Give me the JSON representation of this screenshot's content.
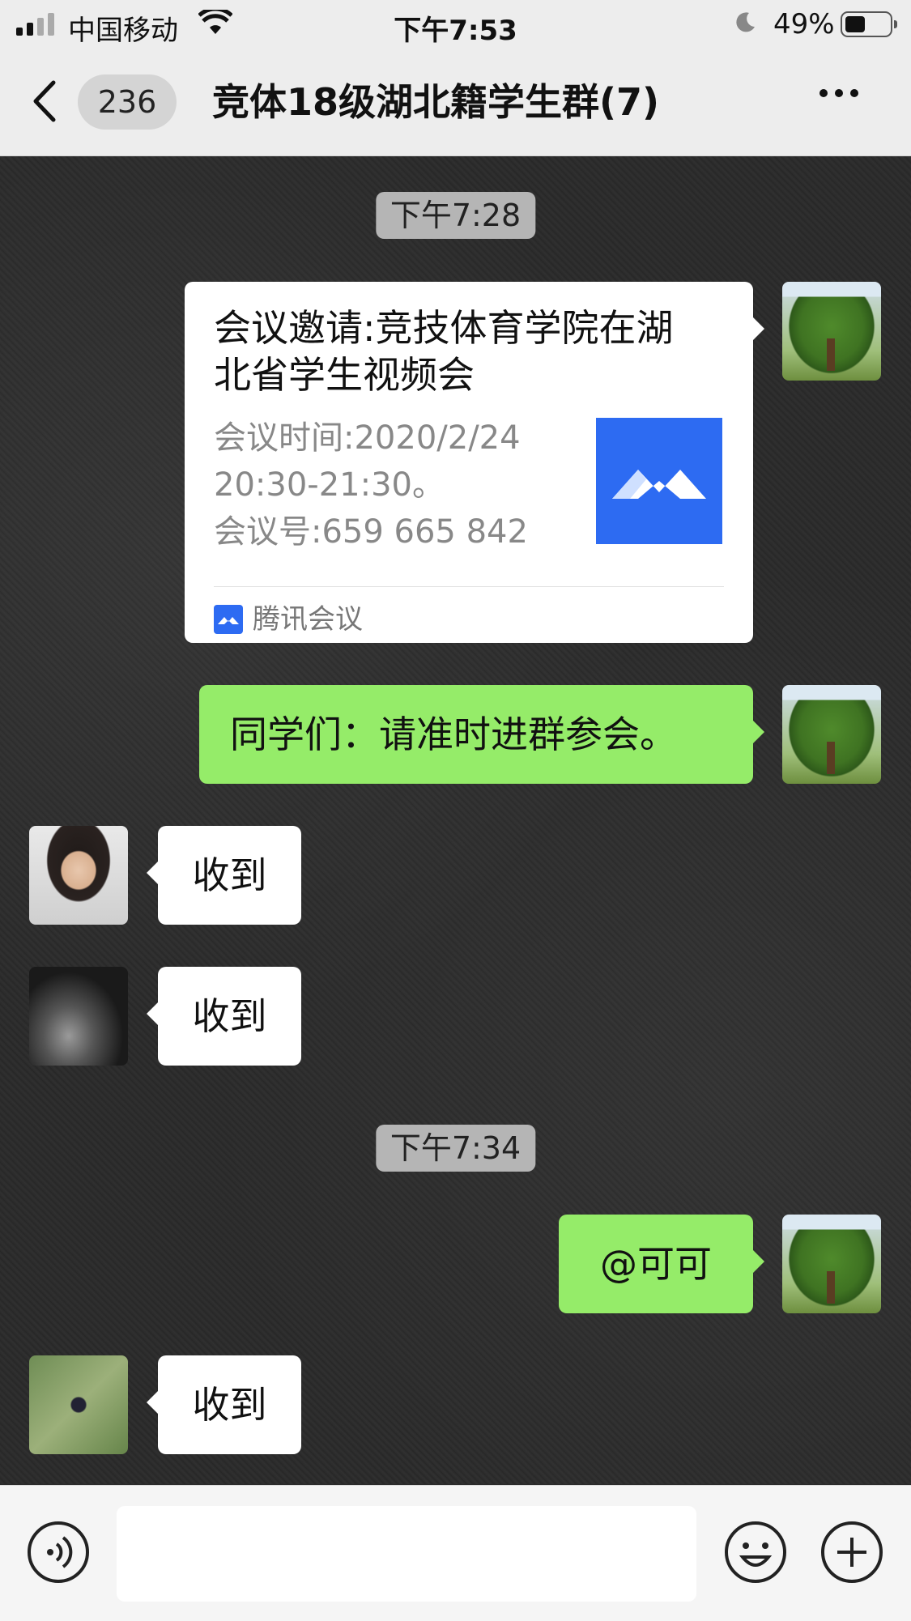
{
  "status_bar": {
    "carrier": "中国移动",
    "time": "下午7:53",
    "battery_percent": "49%",
    "battery_level": 0.49
  },
  "nav": {
    "unread_count": "236",
    "title": "竞体18级湖北籍学生群(7)"
  },
  "chat": {
    "timestamps": [
      "下午7:28",
      "下午7:34"
    ],
    "meeting_card": {
      "title": "会议邀请:竞技体育学院在湖北省学生视频会",
      "time_line1": "会议时间:2020/2/24",
      "time_line2": "20:30-21:30。",
      "meeting_number": "会议号:659 665 842",
      "source": "腾讯会议"
    },
    "messages": [
      {
        "sender": "self",
        "text": "同学们：请准时进群参会。"
      },
      {
        "sender": "other",
        "text": "收到"
      },
      {
        "sender": "other",
        "text": "收到"
      },
      {
        "sender": "self",
        "text": "@可可"
      },
      {
        "sender": "other",
        "text": "收到"
      }
    ]
  },
  "input": {
    "value": "",
    "placeholder": ""
  },
  "icons": {
    "voice": "voice-icon",
    "emoji": "emoji-icon",
    "plus": "plus-icon",
    "back": "back-chevron-icon",
    "more": "more-icon"
  },
  "colors": {
    "self_bubble": "#95ec69",
    "other_bubble": "#ffffff",
    "tencent_meeting_blue": "#2d6bf2"
  }
}
